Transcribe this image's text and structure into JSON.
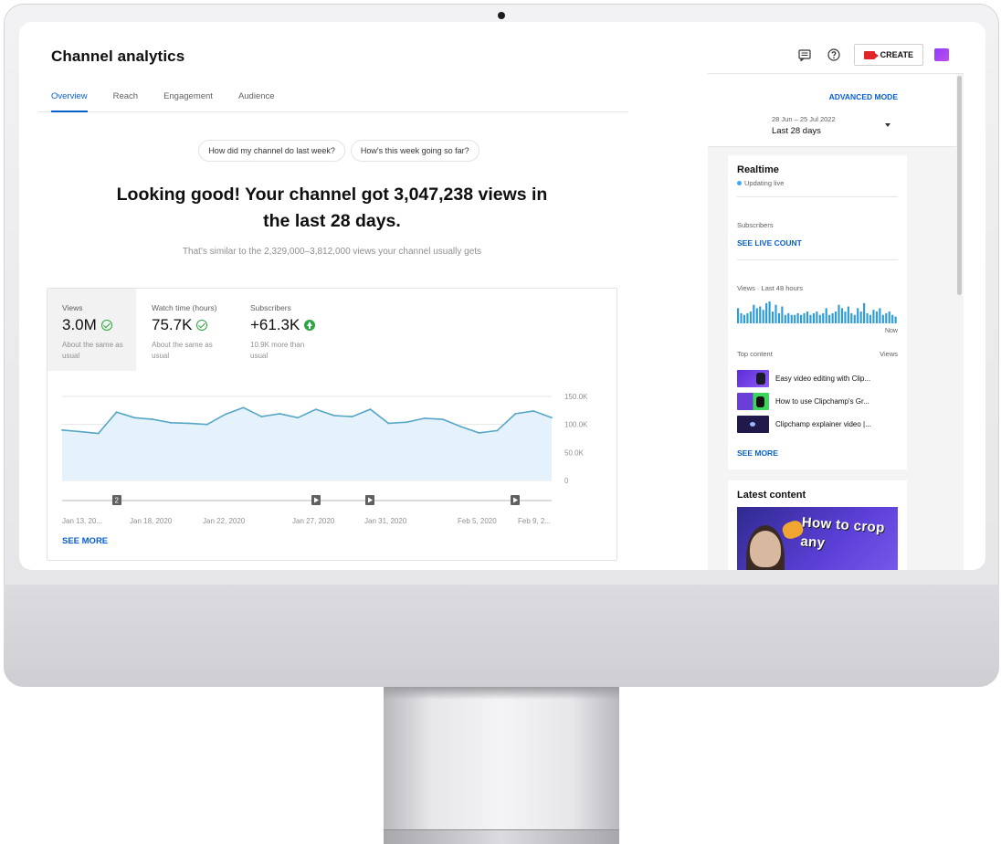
{
  "header": {
    "title": "Channel analytics",
    "create_label": "CREATE"
  },
  "tabs": [
    {
      "label": "Overview",
      "active": true
    },
    {
      "label": "Reach",
      "active": false
    },
    {
      "label": "Engagement",
      "active": false
    },
    {
      "label": "Audience",
      "active": false
    }
  ],
  "chips": [
    "How did my channel do last week?",
    "How's this week going so far?"
  ],
  "summary": {
    "headline": "Looking good! Your channel got 3,047,238 views in the last 28 days.",
    "subline": "That's similar to the 2,329,000–3,812,000 views your channel usually gets"
  },
  "metrics": [
    {
      "label": "Views",
      "value": "3.0M",
      "note": "About the same as usual",
      "status": "check"
    },
    {
      "label": "Watch time (hours)",
      "value": "75.7K",
      "note": "About the same as usual",
      "status": "check"
    },
    {
      "label": "Subscribers",
      "value": "+61.3K",
      "note": "10.9K more than usual",
      "status": "up"
    }
  ],
  "see_more": "SEE MORE",
  "chart_data": {
    "type": "area",
    "title": "",
    "x_tick_labels": [
      "Jan 13, 20...",
      "Jan 18, 2020",
      "Jan 22, 2020",
      "Jan 27, 2020",
      "Jan 31, 2020",
      "Feb 5, 2020",
      "Feb 9, 2..."
    ],
    "y_tick_labels": [
      "150.0K",
      "100.0K",
      "50.0K",
      "0"
    ],
    "ylim": [
      0,
      150000
    ],
    "values": [
      90000,
      87000,
      84000,
      122000,
      112000,
      109000,
      103000,
      102000,
      100000,
      118000,
      130000,
      114000,
      119000,
      112000,
      127000,
      116000,
      114000,
      127000,
      102000,
      104000,
      111000,
      109000,
      96000,
      85000,
      89000,
      119000,
      124000,
      112000
    ],
    "markers": [
      {
        "label": "2",
        "type": "number"
      },
      {
        "label": "",
        "type": "play"
      },
      {
        "label": "",
        "type": "play"
      },
      {
        "label": "",
        "type": "play"
      }
    ],
    "line_color": "#56a7c6",
    "fill_color": "#e5f1fb",
    "grid": true
  },
  "right_panel": {
    "advanced_mode": "ADVANCED MODE",
    "date_range": "28 Jun – 25 Jul 2022",
    "period": "Last 28 days",
    "realtime_title": "Realtime",
    "updating_live": "Updating live",
    "subscribers_label": "Subscribers",
    "see_live_count": "SEE LIVE COUNT",
    "views_48h_label": "Views · Last 48 hours",
    "now_label": "Now",
    "views_48h_bars": [
      18,
      12,
      10,
      12,
      14,
      22,
      18,
      20,
      16,
      24,
      26,
      14,
      22,
      12,
      20,
      10,
      12,
      10,
      10,
      12,
      10,
      12,
      14,
      10,
      12,
      14,
      10,
      12,
      18,
      10,
      12,
      14,
      22,
      18,
      14,
      20,
      12,
      10,
      18,
      14,
      24,
      12,
      10,
      16,
      14,
      18,
      10,
      12,
      14,
      10,
      8
    ],
    "bar_color": "#2d9cd8",
    "top_content_label": "Top content",
    "views_col_label": "Views",
    "top_content": [
      {
        "title": "Easy video editing with Clip...",
        "thumb": "purple"
      },
      {
        "title": "How to use Clipchamp's Gr...",
        "thumb": "green"
      },
      {
        "title": "Clipchamp explainer video |...",
        "thumb": "navy"
      }
    ],
    "top_see_more": "SEE MORE",
    "latest_content_title": "Latest content",
    "latest_thumb_text": "How to crop any"
  }
}
